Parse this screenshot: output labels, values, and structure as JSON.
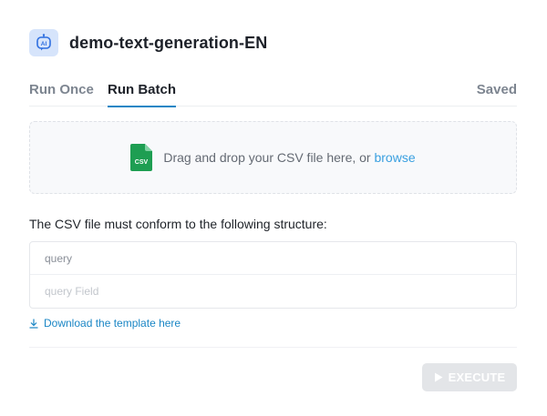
{
  "app": {
    "icon": "ai-robot-icon",
    "icon_text": "AI",
    "title": "demo-text-generation-EN"
  },
  "tabs": [
    {
      "label": "Run Once",
      "active": false
    },
    {
      "label": "Run Batch",
      "active": true
    }
  ],
  "status": {
    "saved_label": "Saved"
  },
  "dropzone": {
    "file_icon": "csv-file-icon",
    "file_icon_text": "CSV",
    "text": "Drag and drop your CSV file here, or ",
    "browse_label": "browse"
  },
  "structure": {
    "label": "The CSV file must conform to the following structure:",
    "columns": [
      "query"
    ],
    "placeholder_row": [
      "query Field"
    ]
  },
  "download": {
    "icon": "download-icon",
    "label": "Download the template here"
  },
  "execute": {
    "icon": "play-icon",
    "label": "EXECUTE",
    "disabled": true
  },
  "colors": {
    "accent": "#1a86c5",
    "link": "#3aa0e0",
    "csv_green": "#1e9e52",
    "icon_bg": "#d6e4fb"
  }
}
